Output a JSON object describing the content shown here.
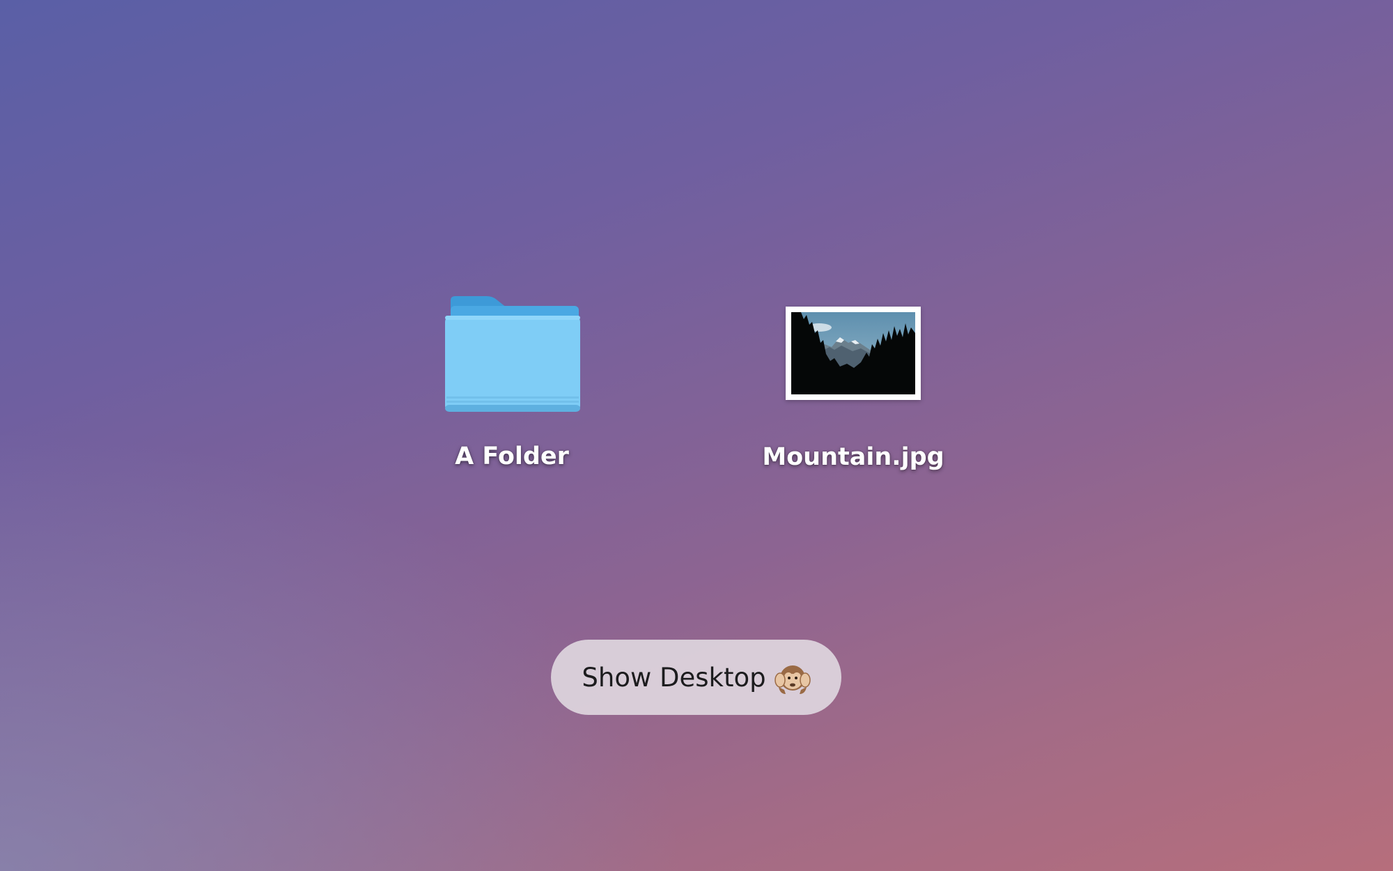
{
  "desktop": {
    "items": [
      {
        "name": "A Folder",
        "type": "folder",
        "icon": "folder-icon"
      },
      {
        "name": "Mountain.jpg",
        "type": "image",
        "icon": "mountain-photo-thumbnail"
      }
    ]
  },
  "show_desktop_button": {
    "label": "Show Desktop",
    "emoji_icon": "hear-no-evil-monkey-icon"
  },
  "colors": {
    "background_top_left": "#5a5fa6",
    "background_bottom_right": "#b66e7c",
    "folder_blue": "#7fcdf6",
    "button_bg": "#ded6de"
  }
}
